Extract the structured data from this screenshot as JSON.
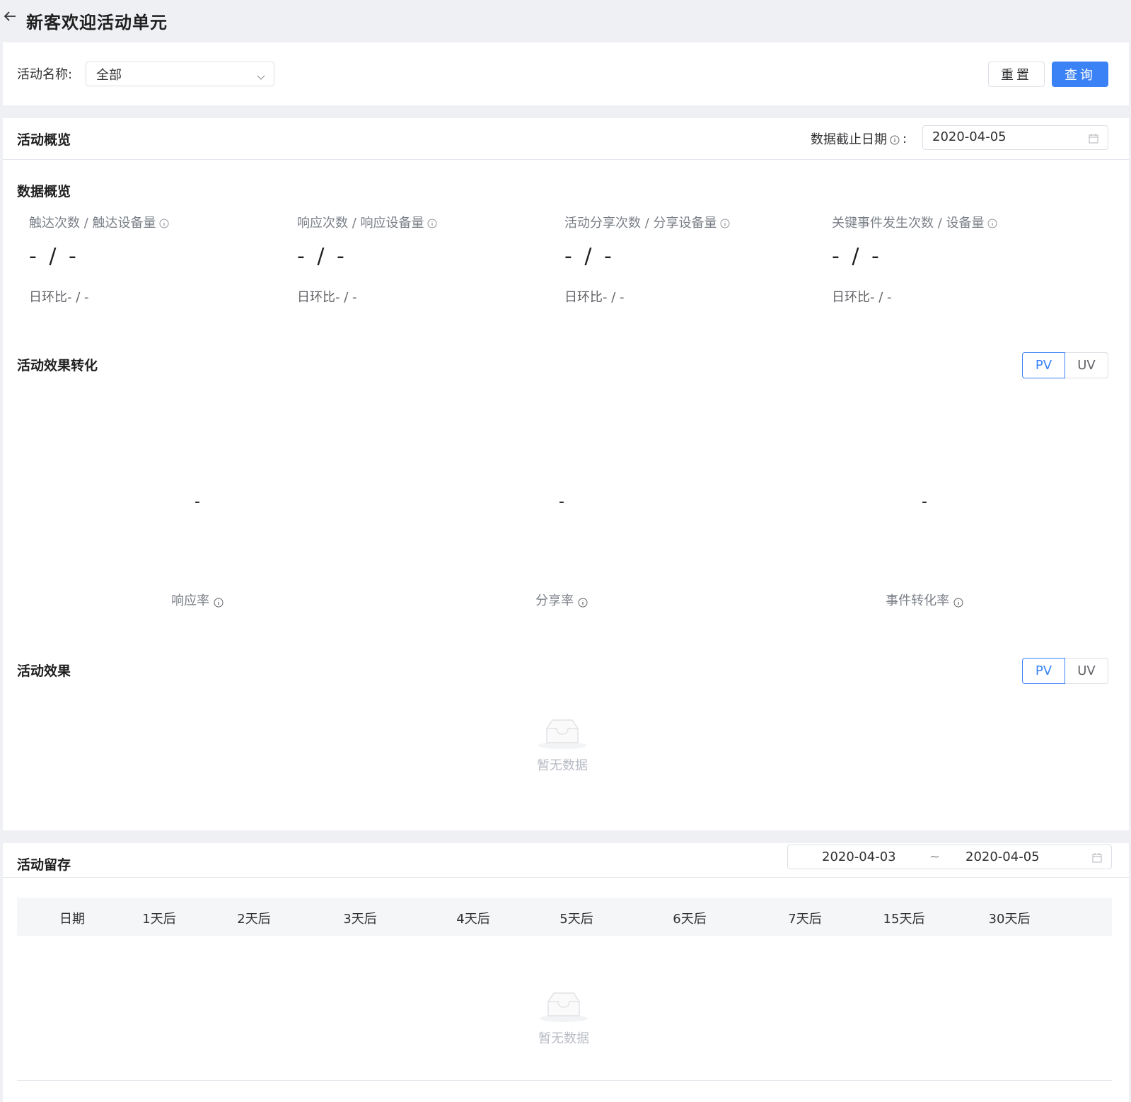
{
  "header": {
    "title": "新客欢迎活动单元"
  },
  "filter": {
    "activity_name_label": "活动名称:",
    "activity_name_value": "全部",
    "reset_label": "重置",
    "query_label": "查询"
  },
  "overview": {
    "title": "活动概览",
    "cutoff_label": "数据截止日期",
    "cutoff_colon": ":",
    "cutoff_value": "2020-04-05"
  },
  "data_overview": {
    "title": "数据概览",
    "metrics": [
      {
        "label": "触达次数 / 触达设备量",
        "value": "- / -",
        "sub": "日环比- / -"
      },
      {
        "label": "响应次数 / 响应设备量",
        "value": "- / -",
        "sub": "日环比- / -"
      },
      {
        "label": "活动分享次数 / 分享设备量",
        "value": "- / -",
        "sub": "日环比- / -"
      },
      {
        "label": "关键事件发生次数 / 设备量",
        "value": "- / -",
        "sub": "日环比- / -"
      }
    ]
  },
  "conversion": {
    "title": "活动效果转化",
    "toggle": [
      "PV",
      "UV"
    ],
    "rates": [
      {
        "value": "-",
        "label": "响应率"
      },
      {
        "value": "-",
        "label": "分享率"
      },
      {
        "value": "-",
        "label": "事件转化率"
      }
    ]
  },
  "effect": {
    "title": "活动效果",
    "toggle": [
      "PV",
      "UV"
    ],
    "empty_text": "暂无数据"
  },
  "retention": {
    "title": "活动留存",
    "date_start": "2020-04-03",
    "date_sep": "~",
    "date_end": "2020-04-05",
    "columns": [
      "日期",
      "1天后",
      "2天后",
      "3天后",
      "4天后",
      "5天后",
      "6天后",
      "7天后",
      "15天后",
      "30天后"
    ],
    "empty_text": "暂无数据"
  },
  "colors": {
    "primary": "#3b82f6",
    "background": "#eef0f4",
    "border": "#dcdfe6",
    "muted_text": "#7a7f87"
  }
}
